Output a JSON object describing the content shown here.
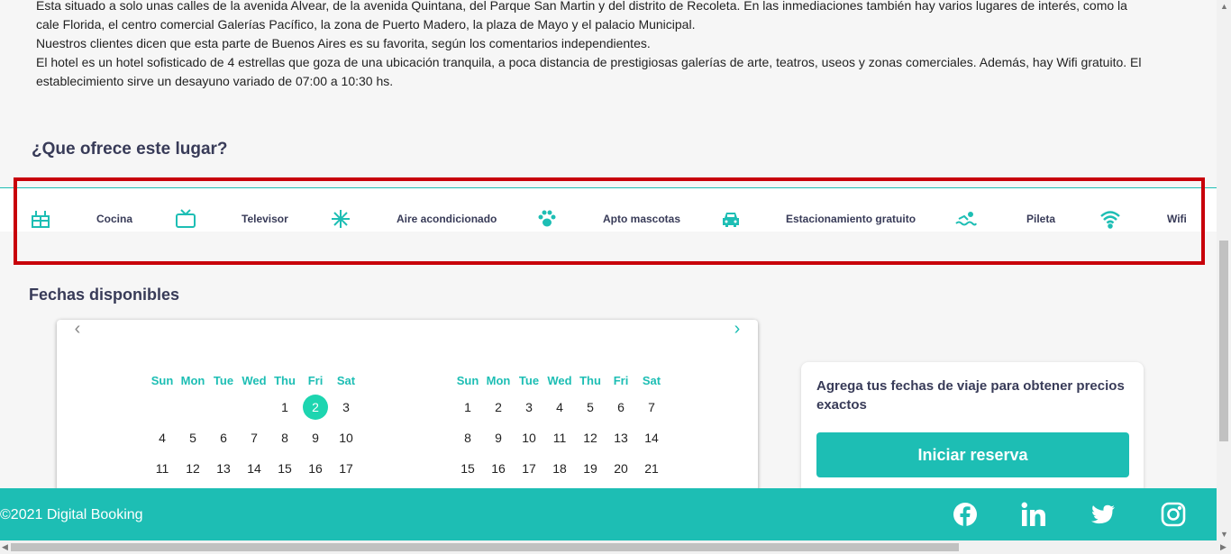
{
  "description": {
    "lines": [
      "Esta situado a solo unas calles de la avenida Alvear, de la avenida Quintana, del Parque San Martin y del distrito de Recoleta. En las inmediaciones también hay varios lugares de interés, como la cale Florida, el centro comercial Galerías Pacífico, la zona de Puerto Madero, la plaza de Mayo y el palacio Municipal.",
      "Nuestros clientes dicen que esta parte de Buenos Aires es su favorita, según los comentarios independientes.",
      "El hotel es un hotel sofisticado de 4 estrellas que goza de una ubicación tranquila, a poca distancia de prestigiosas galerías de arte, teatros, useos y zonas comerciales. Además, hay Wifi gratuito. El establecimiento sirve un desayuno variado de 07:00 a 10:30 hs."
    ]
  },
  "features": {
    "title": "¿Que ofrece este lugar?",
    "items": [
      {
        "label": "Cocina",
        "icon": "kitchen-icon"
      },
      {
        "label": "Televisor",
        "icon": "tv-icon"
      },
      {
        "label": "Aire acondicionado",
        "icon": "snowflake-icon"
      },
      {
        "label": "Apto mascotas",
        "icon": "paw-icon"
      },
      {
        "label": "Estacionamiento gratuito",
        "icon": "car-icon"
      },
      {
        "label": "Pileta",
        "icon": "swimmer-icon"
      },
      {
        "label": "Wifi",
        "icon": "wifi-icon"
      }
    ]
  },
  "dates": {
    "title": "Fechas disponibles",
    "weekdays": [
      "Sun",
      "Mon",
      "Tue",
      "Wed",
      "Thu",
      "Fri",
      "Sat"
    ],
    "months": [
      {
        "days": [
          "",
          "",
          "",
          "",
          "1",
          "2",
          "3",
          "4",
          "5",
          "6",
          "7",
          "8",
          "9",
          "10",
          "11",
          "12",
          "13",
          "14",
          "15",
          "16",
          "17"
        ],
        "selected": "2"
      },
      {
        "days": [
          "1",
          "2",
          "3",
          "4",
          "5",
          "6",
          "7",
          "8",
          "9",
          "10",
          "11",
          "12",
          "13",
          "14",
          "15",
          "16",
          "17",
          "18",
          "19",
          "20",
          "21"
        ],
        "selected": ""
      }
    ]
  },
  "booking": {
    "text": "Agrega tus fechas de viaje para obtener precios exactos",
    "button": "Iniciar reserva"
  },
  "footer": {
    "copyright": "©2021 Digital Booking",
    "social": [
      "facebook-icon",
      "linkedin-icon",
      "twitter-icon",
      "instagram-icon"
    ]
  },
  "colors": {
    "accent": "#1dbeb4",
    "selected_day": "#1dd5b0",
    "heading": "#383b58",
    "highlight_box": "#c8000a"
  }
}
